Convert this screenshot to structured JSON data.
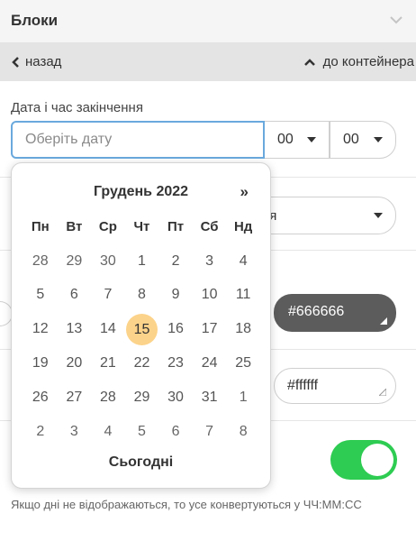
{
  "panel": {
    "title": "Блоки"
  },
  "nav": {
    "back_label": "назад",
    "parent_label": "до контейнера"
  },
  "date_field": {
    "label": "Дата і час закінчення",
    "placeholder": "Оберіть дату",
    "hour_value": "00",
    "minute_value": "00"
  },
  "background_select": {
    "visible_text": "ня"
  },
  "colors": {
    "text_color_value": "#666666",
    "background_color_value": "#ffffff",
    "toggle_color": "#2ecc52",
    "selected_day_color": "#fcd38a"
  },
  "toggle": {
    "on": true
  },
  "help_text": "Якщо дні не відображаються, то усе конвертуються у ЧЧ:ММ:СС",
  "calendar": {
    "month_label": "Грудень 2022",
    "next_label": "»",
    "weekdays": [
      "Пн",
      "Вт",
      "Ср",
      "Чт",
      "Пт",
      "Сб",
      "Нд"
    ],
    "weeks": [
      [
        "28",
        "29",
        "30",
        "1",
        "2",
        "3",
        "4"
      ],
      [
        "5",
        "6",
        "7",
        "8",
        "9",
        "10",
        "11"
      ],
      [
        "12",
        "13",
        "14",
        "15",
        "16",
        "17",
        "18"
      ],
      [
        "19",
        "20",
        "21",
        "22",
        "23",
        "24",
        "25"
      ],
      [
        "26",
        "27",
        "28",
        "29",
        "30",
        "31",
        "1"
      ],
      [
        "2",
        "3",
        "4",
        "5",
        "6",
        "7",
        "8"
      ]
    ],
    "selected_day": "15",
    "today_label": "Сьогодні"
  }
}
